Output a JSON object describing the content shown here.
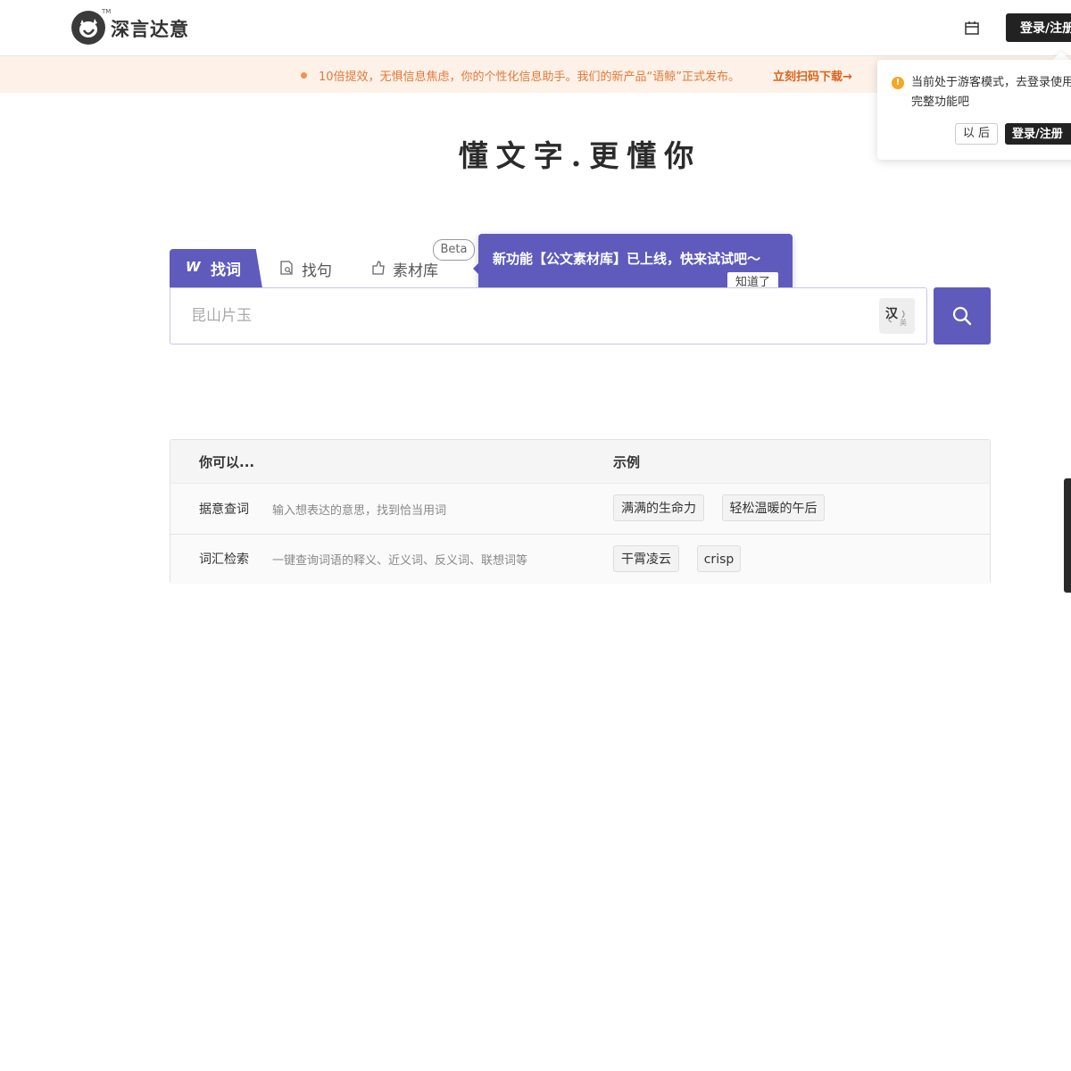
{
  "header": {
    "brand": "深言达意",
    "tm": "TM",
    "login_label": "登录/注册"
  },
  "notice": {
    "text": "10倍提效，无惧信息焦虑，你的个性化信息助手。我们的新产品“语鲸”正式发布。",
    "link": "立刻扫码下载→"
  },
  "guest_popup": {
    "message": "当前处于游客模式，去登录使用完整功能吧",
    "later_label": "以 后",
    "login_label": "登录/注册"
  },
  "slogan": "懂文字.更懂你",
  "tabs": [
    {
      "label": "找词",
      "icon": "W"
    },
    {
      "label": "找句"
    },
    {
      "label": "素材库",
      "badge": "Beta"
    }
  ],
  "tooltip": {
    "text": "新功能【公文素材库】已上线，快来试试吧～",
    "button": "知道了"
  },
  "search": {
    "placeholder": "昆山片玉",
    "lang_main": "汉",
    "lang_sub": "英"
  },
  "table": {
    "headers": [
      "你可以...",
      "示例"
    ],
    "rows": [
      {
        "title": "据意查词",
        "desc": "输入想表达的意思，找到恰当用词",
        "examples": [
          "满满的生命力",
          "轻松温暖的午后"
        ]
      },
      {
        "title": "词汇检索",
        "desc": "一键查询词语的释义、近义词、反义词、联想词等",
        "examples": [
          "干霄凌云",
          "crisp"
        ]
      }
    ]
  },
  "colors": {
    "accent": "#5f5bbd",
    "notice_bg": "#fdf1e8",
    "notice_text": "#e27a3a",
    "warning": "#f5a623"
  }
}
